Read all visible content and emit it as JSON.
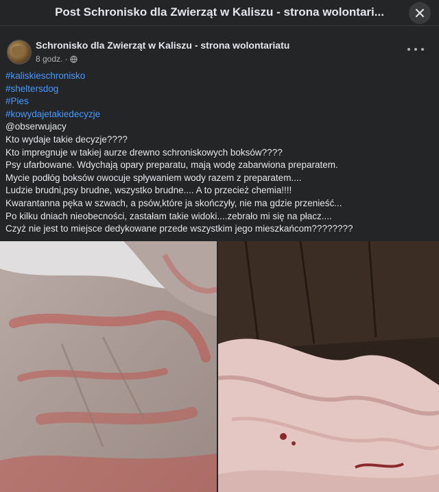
{
  "modal": {
    "title": "Post Schronisko dla Zwierząt w Kaliszu - strona wolontari...",
    "close_icon": "close-icon"
  },
  "post": {
    "author": "Schronisko dla Zwierząt w Kaliszu - strona wolontariatu",
    "time": "8 godz. ·",
    "privacy_icon": "globe-icon",
    "more_icon": "more-options-icon",
    "hashtags": [
      "#kaliskieschronisko",
      "#sheltersdog",
      "#Pies",
      "#kowydajetakiedecyzje"
    ],
    "body_lines": [
      "@obserwujacy",
      "Kto wydaje takie decyzje????",
      "Kto impregnuje w takiej aurze drewno schroniskowych boksów????",
      "Psy ufarbowane. Wdychają opary preparatu, mają wodę zabarwiona preparatem.",
      "Mycie podłóg boksów owocuje spływaniem wody razem z preparatem....",
      "Ludzie brudni,psy brudne, wszystko brudne.... A to przecież chemia!!!!",
      "Kwarantanna pęka w szwach, a psów,które ja skończyły, nie ma gdzie przenieść...",
      "Po kilku dniach nieobecności, zastałam takie widoki....zebrało mi się na płacz....",
      "Czyż nie jest to miejsce dedykowane przede wszystkim jego mieszkańcom????????"
    ],
    "photos": [
      {
        "description_icon": "photo-stained-hand"
      },
      {
        "description_icon": "photo-stained-cloth"
      }
    ]
  },
  "colors": {
    "background": "#242526",
    "text": "#e4e6eb",
    "secondary_text": "#b0b3b8",
    "hashtag": "#4599ff",
    "stain": "#c0504a"
  }
}
